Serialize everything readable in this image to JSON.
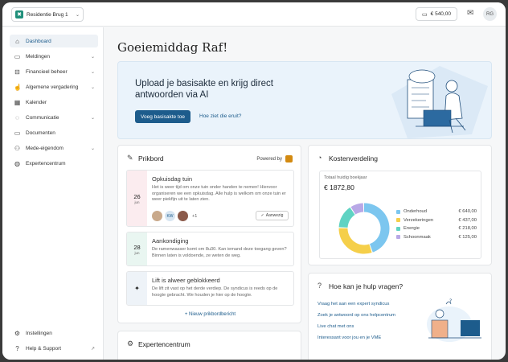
{
  "topbar": {
    "property": "Residentie Brug 1",
    "wallet": "€ 540,00",
    "user_initials": "RG"
  },
  "sidebar": {
    "items": [
      {
        "label": "Dashboard",
        "icon": "home-icon",
        "active": true,
        "chevron": false
      },
      {
        "label": "Meldingen",
        "icon": "folder-icon",
        "chevron": true
      },
      {
        "label": "Financieel beheer",
        "icon": "finance-icon",
        "chevron": true
      },
      {
        "label": "Algemene vergadering",
        "icon": "thumbs-up-icon",
        "chevron": true
      },
      {
        "label": "Kalender",
        "icon": "calendar-icon",
        "chevron": false
      },
      {
        "label": "Communicatie",
        "icon": "chat-icon",
        "chevron": true
      },
      {
        "label": "Documenten",
        "icon": "folder-icon",
        "chevron": false
      },
      {
        "label": "Mede-eigendom",
        "icon": "users-icon",
        "chevron": true
      },
      {
        "label": "Expertencentrum",
        "icon": "globe-icon",
        "chevron": false
      }
    ],
    "bottom": [
      {
        "label": "Instellingen",
        "icon": "gear-icon"
      },
      {
        "label": "Help & Support",
        "icon": "help-icon"
      }
    ]
  },
  "greeting": "Goeiemiddag Raf!",
  "banner": {
    "title": "Upload je basisakte en krijg direct antwoorden via AI",
    "button": "Voeg basisakte toe",
    "link": "Hoe ziet die eruit?"
  },
  "prikbord": {
    "title": "Prikbord",
    "powered": "Powered by",
    "posts": [
      {
        "day": "26",
        "month": "jun",
        "title": "Opkuisdag tuin",
        "body": "Het is weer tijd om onze tuin onder handen te nemen! Hiervoor organiseren we een opkuisdag. Alle hulp is welkom om onze tuin er weer piekfijn uit te laten zien.",
        "extra": "+1",
        "attend": "Aanwezig",
        "color": "#fbecef"
      },
      {
        "day": "28",
        "month": "jun",
        "title": "Aankondiging",
        "body": "De ramenwasser komt om 8u30. Kan iemand deze toegang geven? Binnen laten is voldoende, ze weten de weg.",
        "color": "#e9f6f1"
      },
      {
        "day": "",
        "month": "",
        "title": "Lift is alweer geblokkeerd",
        "body": "De lift zit vast op het derde verdiep. De syndicus is reeds op de hoogte gebracht. We houden je hier op de hoogte.",
        "color": "#eef3f8"
      }
    ],
    "new_post": "+ Nieuw prikbordbericht"
  },
  "kosten": {
    "title": "Kostenverdeling",
    "subtitle": "Totaal huidig boekjaar",
    "total": "€ 1872,80",
    "items": [
      {
        "label": "Onderhoud",
        "value": "€ 640,00",
        "amount": 640,
        "color": "#7cc6ef"
      },
      {
        "label": "Verzekeringen",
        "value": "€ 437,00",
        "amount": 437,
        "color": "#f5cf4a"
      },
      {
        "label": "Energie",
        "value": "€ 218,00",
        "amount": 218,
        "color": "#5fd3c3"
      },
      {
        "label": "Schoonmaak",
        "value": "€ 125,00",
        "amount": 125,
        "color": "#b8a8e6"
      }
    ]
  },
  "hulp": {
    "title": "Hoe kan je hulp vragen?",
    "links": [
      "Vraag het aan een expert syndicus",
      "Zoek je antwoord op ons helpcentrum",
      "Live chat met ons",
      "Interessant voor jou en je VME"
    ]
  },
  "expert": {
    "title": "Expertencentrum"
  }
}
